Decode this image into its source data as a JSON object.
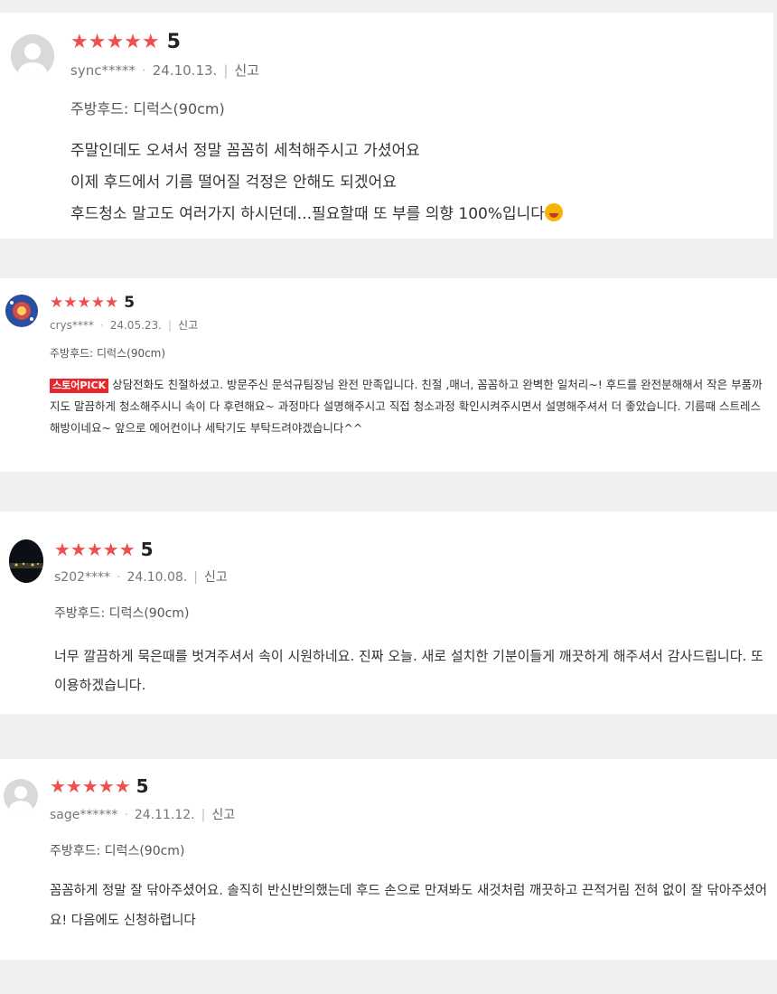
{
  "reviews": [
    {
      "stars": "★★★★★",
      "rating": "5",
      "user": "sync*****",
      "date": "24.10.13.",
      "report": "신고",
      "option": "주방후드: 디럭스(90cm)",
      "avatar_icon": "default-avatar-icon",
      "lines": [
        "주말인데도 오셔서 정말 꼼꼼히 세척해주시고 가셨어요",
        "이제 후드에서 기름 떨어질 걱정은 안해도 되겠어요",
        "후드청소 말고도 여러가지 하시던데...필요할때 또 부를 의향 100%입니다"
      ],
      "emoji_icon": "grinning-face-emoji-icon"
    },
    {
      "stars": "★★★★★",
      "rating": "5",
      "user": "crys****",
      "date": "24.05.23.",
      "report": "신고",
      "option": "주방후드: 디럭스(90cm)",
      "avatar_icon": "planet-avatar-icon",
      "badge": "스토어PICK",
      "text": "상담전화도 친절하셨고.  방문주신 문석규팀장님 완전 만족입니다. 친절 ,매너, 꼼꼼하고 완벽한 일처리~! 후드를  완전분해해서 작은 부품까지도 말끔하게 청소해주시니 속이 다 후련해요~ 과정마다 설명해주시고 직접 청소과정  확인시켜주시면서 설명해주셔서 더 좋았습니다.  기름때 스트레스 해방이네요~ 앞으로 에어컨이나 세탁기도 부탁드려야겠습니다^^"
    },
    {
      "stars": "★★★★★",
      "rating": "5",
      "user": "s202****",
      "date": "24.10.08.",
      "report": "신고",
      "option": "주방후드: 디럭스(90cm)",
      "avatar_icon": "night-city-avatar-icon",
      "text": "너무 깔끔하게 묵은때를 벗겨주셔서 속이 시원하네요. 진짜 오늘. 새로 설치한 기분이들게 깨끗하게 해주셔서 감사드립니다. 또 이용하겠습니다."
    },
    {
      "stars": "★★★★★",
      "rating": "5",
      "user": "sage******",
      "date": "24.11.12.",
      "report": "신고",
      "option": "주방후드: 디럭스(90cm)",
      "avatar_icon": "default-avatar-icon",
      "text": "꼼꼼하게 정말 잘 닦아주셨어요. 솔직히 반신반의했는데 후드 손으로 만져봐도 새것처럼 깨끗하고 끈적거림 전혀 없이 잘 닦아주셨어요! 다음에도 신청하렵니다"
    }
  ],
  "colors": {
    "star": "#f04f4f",
    "badge": "#e8262e",
    "background": "#efefef",
    "card": "#ffffff"
  }
}
